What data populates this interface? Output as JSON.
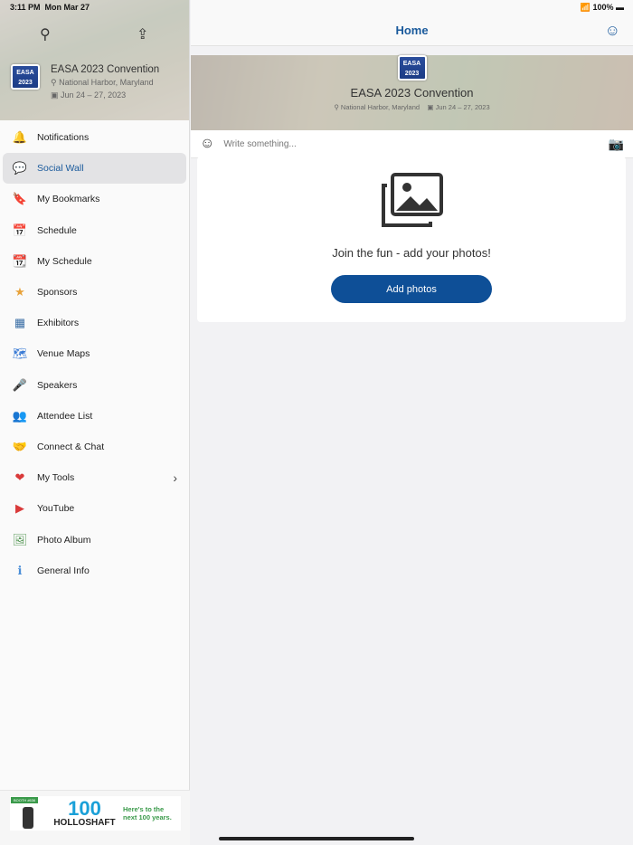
{
  "status": {
    "time": "3:11 PM",
    "date": "Mon Mar 27",
    "battery": "100%"
  },
  "event": {
    "logo_text": "EASA 2023",
    "name": "EASA 2023 Convention",
    "location": "National Harbor, Maryland",
    "dates": "Jun 24 – 27, 2023"
  },
  "sidebar": {
    "items": [
      {
        "label": "Notifications",
        "icon": "bell-icon",
        "glyph": "🔔"
      },
      {
        "label": "Social Wall",
        "icon": "chat-icon",
        "glyph": "💬"
      },
      {
        "label": "My Bookmarks",
        "icon": "bookmark-icon",
        "glyph": "🔖"
      },
      {
        "label": "Schedule",
        "icon": "calendar-icon",
        "glyph": "📅"
      },
      {
        "label": "My Schedule",
        "icon": "calendar-check-icon",
        "glyph": "📆"
      },
      {
        "label": "Sponsors",
        "icon": "star-icon",
        "glyph": "★"
      },
      {
        "label": "Exhibitors",
        "icon": "exhibitors-icon",
        "glyph": "▦"
      },
      {
        "label": "Venue Maps",
        "icon": "map-icon",
        "glyph": "🗺"
      },
      {
        "label": "Speakers",
        "icon": "podium-icon",
        "glyph": "🎤"
      },
      {
        "label": "Attendee List",
        "icon": "people-icon",
        "glyph": "👥"
      },
      {
        "label": "Connect & Chat",
        "icon": "handshake-icon",
        "glyph": "🤝"
      },
      {
        "label": "My Tools",
        "icon": "heart-icon",
        "glyph": "❤"
      },
      {
        "label": "YouTube",
        "icon": "youtube-icon",
        "glyph": "▶"
      },
      {
        "label": "Photo Album",
        "icon": "photo-icon",
        "glyph": "🖼"
      },
      {
        "label": "General Info",
        "icon": "info-icon",
        "glyph": "ℹ"
      }
    ]
  },
  "ad": {
    "badge": "BOOTH #636",
    "brand": "HOLLOSHAFT",
    "number": "100",
    "tagline": "Here's to the next 100 years."
  },
  "main": {
    "title": "Home",
    "compose_placeholder": "Write something...",
    "empty_message": "Join the fun - add your photos!",
    "add_photos_label": "Add photos"
  }
}
